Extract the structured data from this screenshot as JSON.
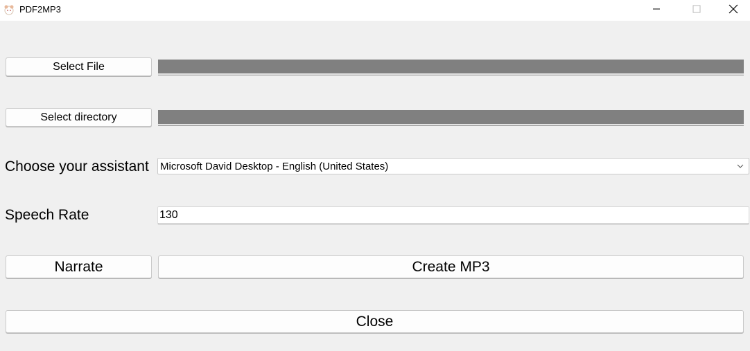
{
  "window": {
    "title": "PDF2MP3",
    "icon": "app-logo-icon",
    "controls": {
      "minimize_icon": "minimize-icon",
      "maximize_icon": "maximize-icon",
      "close_icon": "close-icon"
    }
  },
  "file": {
    "button_label": "Select File",
    "path_value": ""
  },
  "directory": {
    "button_label": "Select directory",
    "path_value": ""
  },
  "assistant": {
    "label": "Choose your assistant",
    "selected": "Microsoft David Desktop - English (United States)"
  },
  "speech_rate": {
    "label": "Speech Rate",
    "value": "130"
  },
  "actions": {
    "narrate_label": "Narrate",
    "create_mp3_label": "Create MP3",
    "close_label": "Close"
  },
  "colors": {
    "background": "#f0f0f0",
    "path_field_fill": "#808080",
    "button_fill": "#fdfdfd"
  }
}
